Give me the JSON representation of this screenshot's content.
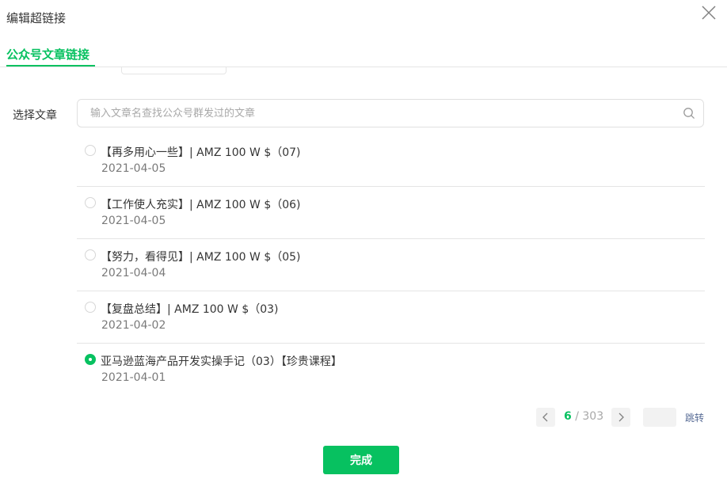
{
  "dialog": {
    "title": "编辑超链接"
  },
  "tabs": [
    {
      "label": "公众号文章链接",
      "active": true
    }
  ],
  "field_label": "选择文章",
  "search": {
    "placeholder": "输入文章名查找公众号群发过的文章",
    "value": ""
  },
  "articles": [
    {
      "title": "【再多用心一些】| AMZ 100 W $（07)",
      "date": "2021-04-05",
      "selected": false
    },
    {
      "title": "【工作使人充实】| AMZ 100 W $（06)",
      "date": "2021-04-05",
      "selected": false
    },
    {
      "title": "【努力，看得见】| AMZ 100 W $（05)",
      "date": "2021-04-04",
      "selected": false
    },
    {
      "title": "【复盘总结】| AMZ 100 W $（03)",
      "date": "2021-04-02",
      "selected": false
    },
    {
      "title": "亚马逊蓝海产品开发实操手记（03）【珍贵课程】",
      "date": "2021-04-01",
      "selected": true
    }
  ],
  "pagination": {
    "current": "6",
    "separator": "/",
    "total": "303",
    "jump_label": "跳转"
  },
  "done_button": {
    "label": "完成"
  },
  "colors": {
    "accent": "#07c160",
    "link": "#576b95",
    "divider": "#e5e5e5"
  }
}
